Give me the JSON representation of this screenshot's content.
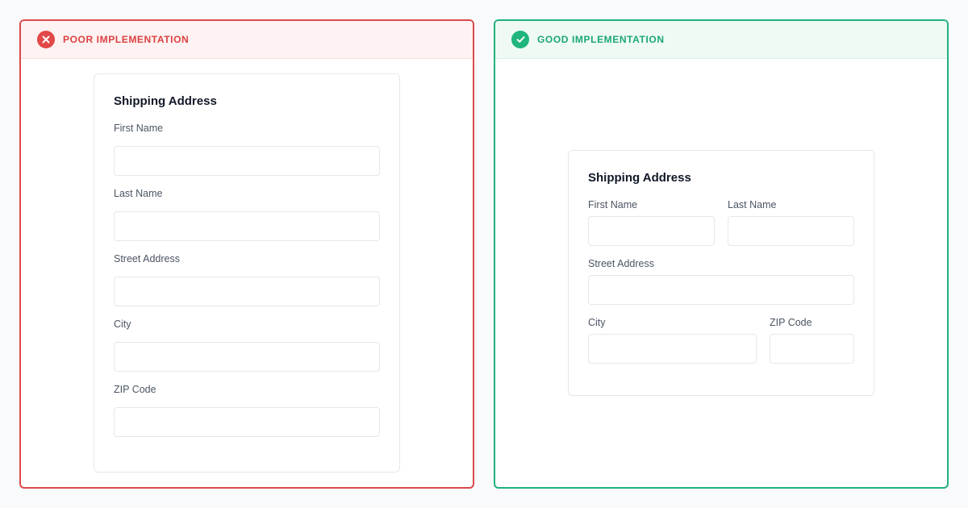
{
  "poor": {
    "header": "POOR IMPLEMENTATION",
    "icon": "x-circle-icon",
    "color": "#dc4a4a",
    "form": {
      "title": "Shipping Address",
      "fields": [
        {
          "label": "First Name",
          "value": ""
        },
        {
          "label": "Last Name",
          "value": ""
        },
        {
          "label": "Street Address",
          "value": ""
        },
        {
          "label": "City",
          "value": ""
        },
        {
          "label": "ZIP Code",
          "value": ""
        }
      ]
    }
  },
  "good": {
    "header": "GOOD IMPLEMENTATION",
    "icon": "check-circle-icon",
    "color": "#22b07d",
    "form": {
      "title": "Shipping Address",
      "fields": [
        {
          "label": "First Name",
          "value": ""
        },
        {
          "label": "Last Name",
          "value": ""
        },
        {
          "label": "Street Address",
          "value": ""
        },
        {
          "label": "City",
          "value": ""
        },
        {
          "label": "ZIP Code",
          "value": ""
        }
      ]
    }
  }
}
